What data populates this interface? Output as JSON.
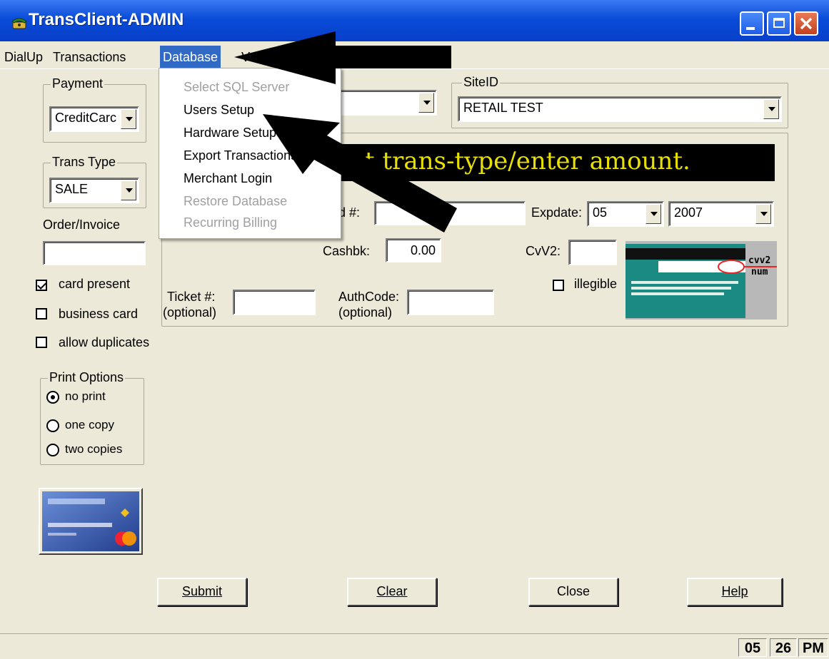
{
  "window": {
    "title": "TransClient-ADMIN"
  },
  "menubar": {
    "items": [
      "DialUp",
      "Transactions",
      "Database",
      "V"
    ]
  },
  "database_menu": {
    "items": [
      {
        "label": "Select SQL Server",
        "enabled": false
      },
      {
        "label": "Users Setup",
        "enabled": true
      },
      {
        "label": "Hardware Setup",
        "enabled": true
      },
      {
        "label": "Export Transactions",
        "enabled": true
      },
      {
        "label": "Merchant Login",
        "enabled": true
      },
      {
        "label": "Restore Database",
        "enabled": false
      },
      {
        "label": "Recurring Billing",
        "enabled": false
      }
    ]
  },
  "payment": {
    "legend": "Payment",
    "value": "CreditCarc"
  },
  "trans_type": {
    "legend": "Trans Type",
    "value": "SALE"
  },
  "order_invoice": {
    "label": "Order/Invoice",
    "value": ""
  },
  "checkboxes": {
    "card_present": {
      "label": "card present",
      "checked": true
    },
    "business_card": {
      "label": "business card",
      "checked": false
    },
    "allow_duplicates": {
      "label": "allow duplicates",
      "checked": false
    }
  },
  "print_options": {
    "legend": "Print Options",
    "options": [
      "no print",
      "one copy",
      "two copies"
    ],
    "selected": "no print"
  },
  "site": {
    "legend": "SiteID",
    "value": "RETAIL TEST"
  },
  "banner": {
    "text": "t trans-type/enter amount."
  },
  "card_number": {
    "label": "rd #:",
    "value": ""
  },
  "expdate": {
    "label": "Expdate:",
    "month": "05",
    "year": "2007"
  },
  "cashbk": {
    "label": "Cashbk:",
    "value": "0.00"
  },
  "cvv2": {
    "label": "CvV2:",
    "value": "",
    "illegible_label": "illegible",
    "illegible_checked": false,
    "image_caption_1": "cvv2",
    "image_caption_2": "num"
  },
  "ticket": {
    "label_1": "Ticket #:",
    "label_2": "(optional)",
    "value": ""
  },
  "authcode": {
    "label_1": "AuthCode:",
    "label_2": "(optional)",
    "value": ""
  },
  "buttons": {
    "submit": "Submit",
    "clear": "Clear",
    "close": "Close",
    "help": "Help"
  },
  "status": {
    "hour": "05",
    "minute": "26",
    "ampm": "PM"
  },
  "colors": {
    "titlebar": "#0a4bd8",
    "menu_highlight": "#316ac5",
    "banner_text": "#e8e000",
    "disabled_text": "#a0a0a0"
  }
}
